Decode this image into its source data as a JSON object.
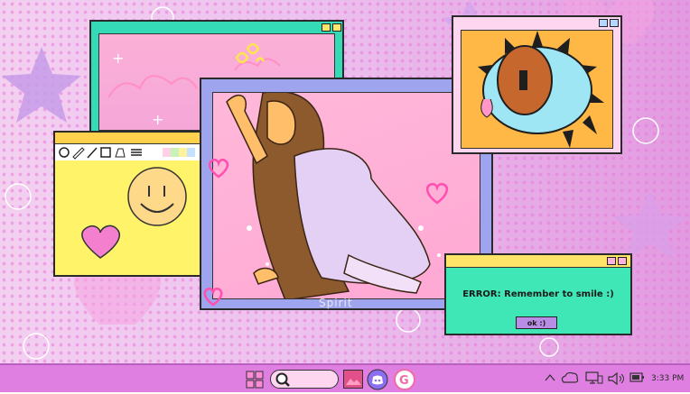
{
  "dialog": {
    "message": "ERROR: Remember to smile :)",
    "ok_label": "ok :)"
  },
  "taskbar": {
    "clock": "3:33 PM"
  },
  "watermark": "Spirit",
  "icons": [
    "windows-icon",
    "search-icon",
    "photo-app-icon",
    "discord-icon",
    "g-app-icon",
    "chevron-up-icon",
    "cloud-icon",
    "monitor-icon",
    "volume-icon",
    "battery-icon"
  ],
  "colors": {
    "taskbar": "#df7fe1",
    "dialog_bg": "#3fe6b6",
    "dialog_title": "#ffe46a",
    "ok_button": "#b98de6"
  }
}
